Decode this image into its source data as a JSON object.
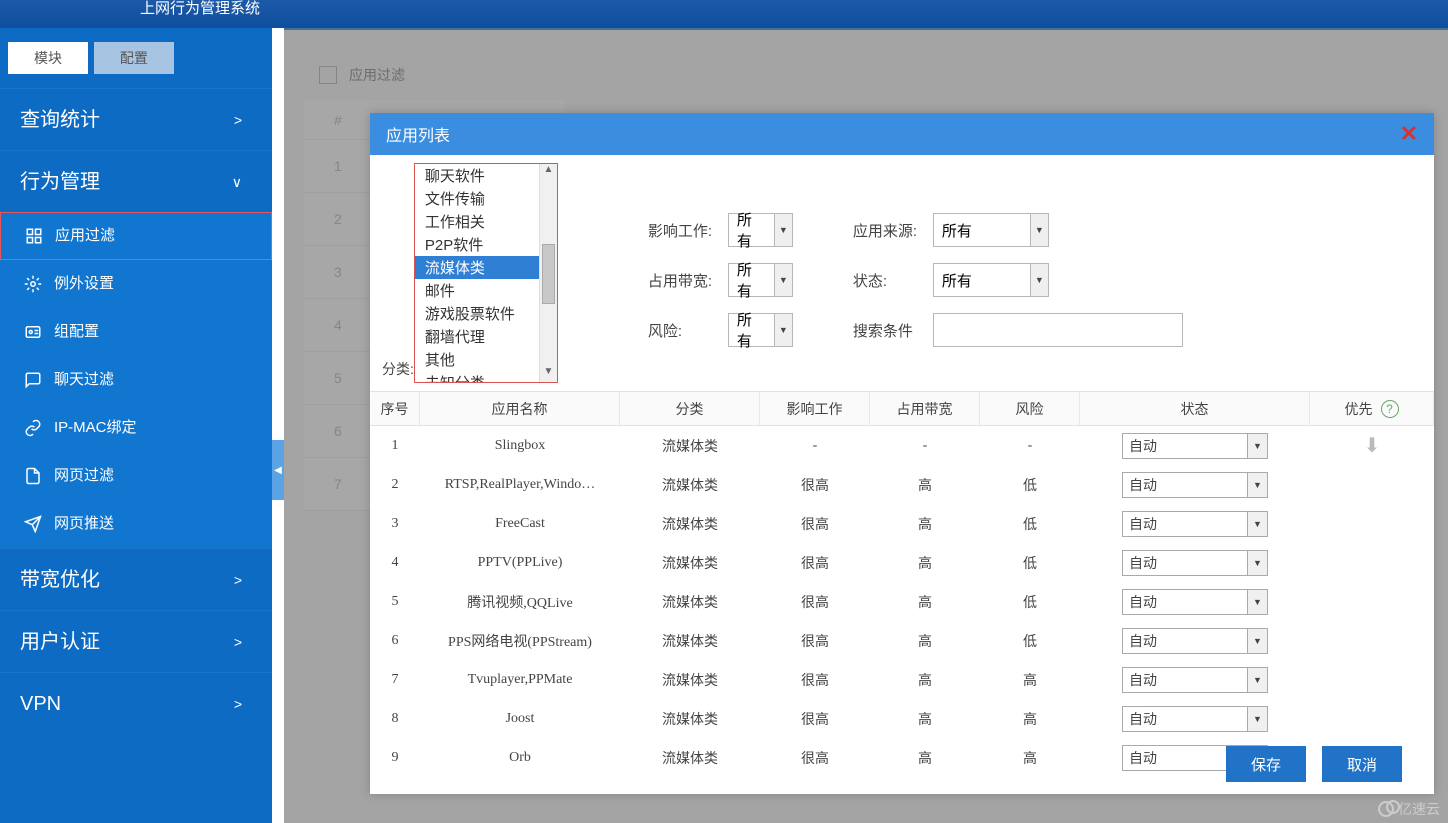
{
  "header": {
    "title": "上网行为管理系统"
  },
  "sidebar": {
    "tabs": {
      "module": "模块",
      "config": "配置"
    },
    "groups": [
      {
        "label": "查询统计",
        "caret": ">"
      },
      {
        "label": "行为管理",
        "caret": "v",
        "expanded": true,
        "items": [
          {
            "label": "应用过滤",
            "selected": true,
            "icon": "filter-icon"
          },
          {
            "label": "例外设置",
            "icon": "gear-icon"
          },
          {
            "label": "组配置",
            "icon": "group-icon"
          },
          {
            "label": "聊天过滤",
            "icon": "chat-icon"
          },
          {
            "label": "IP-MAC绑定",
            "icon": "link-icon"
          },
          {
            "label": "网页过滤",
            "icon": "page-icon"
          },
          {
            "label": "网页推送",
            "icon": "send-icon"
          }
        ]
      },
      {
        "label": "带宽优化",
        "caret": ">"
      },
      {
        "label": "用户认证",
        "caret": ">"
      },
      {
        "label": "VPN",
        "caret": ">"
      }
    ]
  },
  "bg": {
    "crumb": "应用过滤",
    "hash": "#",
    "rows": [
      "1",
      "2",
      "3",
      "4",
      "5",
      "6",
      "7"
    ]
  },
  "modal": {
    "title": "应用列表",
    "category_label": "分类:",
    "categories": [
      "聊天软件",
      "文件传输",
      "工作相关",
      "P2P软件",
      "流媒体类",
      "邮件",
      "游戏股票软件",
      "翻墙代理",
      "其他",
      "未知分类"
    ],
    "selected_category": "流媒体类",
    "filters": {
      "work": {
        "label": "影响工作:",
        "value": "所有"
      },
      "band": {
        "label": "占用带宽:",
        "value": "所有"
      },
      "risk": {
        "label": "风险:",
        "value": "所有"
      },
      "source": {
        "label": "应用来源:",
        "value": "所有"
      },
      "status": {
        "label": "状态:",
        "value": "所有"
      },
      "search": {
        "label": "搜索条件",
        "value": ""
      }
    },
    "columns": {
      "idx": "序号",
      "name": "应用名称",
      "cat": "分类",
      "work": "影响工作",
      "band": "占用带宽",
      "risk": "风险",
      "stat": "状态",
      "prio": "优先"
    },
    "rows": [
      {
        "idx": "1",
        "name": "Slingbox",
        "cat": "流媒体类",
        "work": "-",
        "band": "-",
        "risk": "-",
        "stat": "自动"
      },
      {
        "idx": "2",
        "name": "RTSP,RealPlayer,Windo…",
        "cat": "流媒体类",
        "work": "很高",
        "band": "高",
        "risk": "低",
        "stat": "自动"
      },
      {
        "idx": "3",
        "name": "FreeCast",
        "cat": "流媒体类",
        "work": "很高",
        "band": "高",
        "risk": "低",
        "stat": "自动"
      },
      {
        "idx": "4",
        "name": "PPTV(PPLive)",
        "cat": "流媒体类",
        "work": "很高",
        "band": "高",
        "risk": "低",
        "stat": "自动"
      },
      {
        "idx": "5",
        "name": "腾讯视频,QQLive",
        "cat": "流媒体类",
        "work": "很高",
        "band": "高",
        "risk": "低",
        "stat": "自动"
      },
      {
        "idx": "6",
        "name": "PPS网络电视(PPStream)",
        "cat": "流媒体类",
        "work": "很高",
        "band": "高",
        "risk": "低",
        "stat": "自动"
      },
      {
        "idx": "7",
        "name": "Tvuplayer,PPMate",
        "cat": "流媒体类",
        "work": "很高",
        "band": "高",
        "risk": "高",
        "stat": "自动"
      },
      {
        "idx": "8",
        "name": "Joost",
        "cat": "流媒体类",
        "work": "很高",
        "band": "高",
        "risk": "高",
        "stat": "自动"
      },
      {
        "idx": "9",
        "name": "Orb",
        "cat": "流媒体类",
        "work": "很高",
        "band": "高",
        "risk": "高",
        "stat": "自动"
      }
    ],
    "buttons": {
      "save": "保存",
      "cancel": "取消"
    }
  },
  "watermark": "亿速云"
}
